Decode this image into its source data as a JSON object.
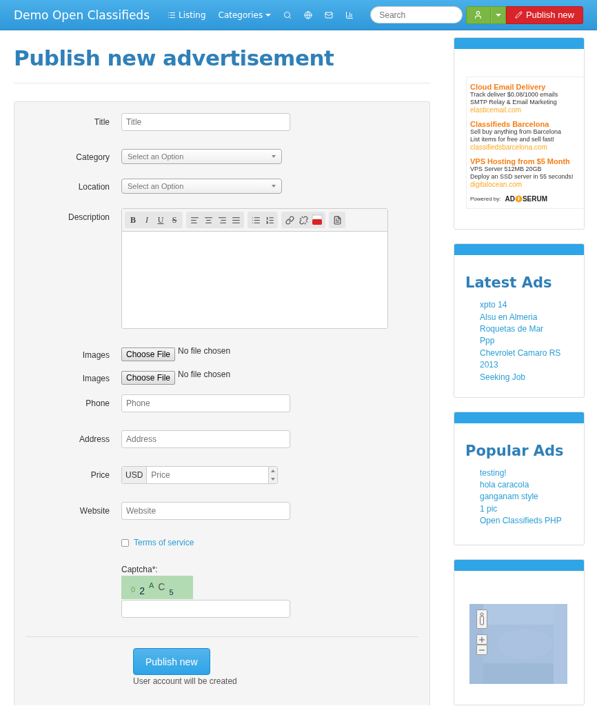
{
  "navbar": {
    "brand": "Demo Open Classifieds",
    "items": [
      {
        "kind": "list",
        "label": "Listing"
      },
      {
        "kind": "dropdown",
        "label": "Categories"
      },
      {
        "kind": "search"
      },
      {
        "kind": "globe"
      },
      {
        "kind": "mail"
      },
      {
        "kind": "signal"
      }
    ],
    "search": {
      "placeholder": "Search"
    },
    "publish": "Publish new"
  },
  "heading": "Publish new advertisement",
  "fields": [
    {
      "kind": "text",
      "label": "Title",
      "placeholder": "Title"
    },
    {
      "kind": "select",
      "label": "Category",
      "placeholder": "Select an Option"
    },
    {
      "kind": "select",
      "label": "Location",
      "placeholder": "Select an Option"
    },
    {
      "kind": "editor",
      "label": "Description",
      "toolbar": [
        [
          {
            "kind": "bold",
            "label": "B"
          },
          {
            "kind": "italic",
            "label": "I"
          },
          {
            "kind": "underline",
            "label": "U"
          },
          {
            "kind": "strike",
            "label": "S"
          }
        ],
        [
          {
            "kind": "align-left"
          },
          {
            "kind": "align-center"
          },
          {
            "kind": "align-right"
          },
          {
            "kind": "justify"
          }
        ],
        [
          {
            "kind": "bullets"
          },
          {
            "kind": "numbers"
          }
        ],
        [
          {
            "kind": "link"
          },
          {
            "kind": "unlink"
          },
          {
            "kind": "video"
          }
        ],
        [
          {
            "kind": "source"
          }
        ]
      ]
    },
    {
      "kind": "file",
      "label": "Images",
      "button": "Choose File",
      "status": "No file chosen"
    },
    {
      "kind": "file",
      "label": "Images",
      "button": "Choose File",
      "status": "No file chosen"
    },
    {
      "kind": "text",
      "label": "Phone",
      "placeholder": "Phone"
    },
    {
      "kind": "text",
      "label": "Address",
      "placeholder": "Address"
    },
    {
      "kind": "price",
      "label": "Price",
      "addon": "USD",
      "placeholder": "Price"
    },
    {
      "kind": "text",
      "label": "Website",
      "placeholder": "Website"
    },
    {
      "kind": "checkbox",
      "checked": false,
      "link": "Terms of service"
    },
    {
      "kind": "captcha",
      "label": "Captcha*:",
      "chars": [
        "0",
        "2",
        "A",
        "C",
        "5"
      ]
    }
  ],
  "submit": {
    "label": "Publish new",
    "note": "User account will be created"
  },
  "sidebar": {
    "ads": [
      {
        "title": "Cloud Email Delivery",
        "lines": [
          "Track deliver $0.08/1000 emails",
          "SMTP Relay & Email Marketing"
        ],
        "url": "elasticemail.com"
      },
      {
        "title": "Classifieds Barcelona",
        "lines": [
          "Sell buy anything from Barcelona",
          "List items for free and sell fast!"
        ],
        "url": "classifiedsbarcelona.com"
      },
      {
        "title": "VPS Hosting from $5 Month",
        "lines": [
          "VPS Server 512MB 20GB",
          "Deploy an SSD server in 55 seconds!"
        ],
        "url": "digitalocean.com"
      }
    ],
    "powered_by": "Powered by:",
    "ad_logo": [
      "AD",
      "SERUM"
    ],
    "lists": [
      {
        "title": "Latest Ads",
        "items": [
          "xpto 14",
          "Alsu en Almeria",
          "Roquetas de Mar",
          "Ppp",
          "Chevrolet Camaro RS 2013",
          "Seeking Job"
        ]
      },
      {
        "title": "Popular Ads",
        "items": [
          "testing!",
          "hola caracola",
          "ganganam style",
          "1 pic",
          "Open Classifieds PHP"
        ]
      }
    ],
    "map": {
      "kind": "picture"
    }
  }
}
